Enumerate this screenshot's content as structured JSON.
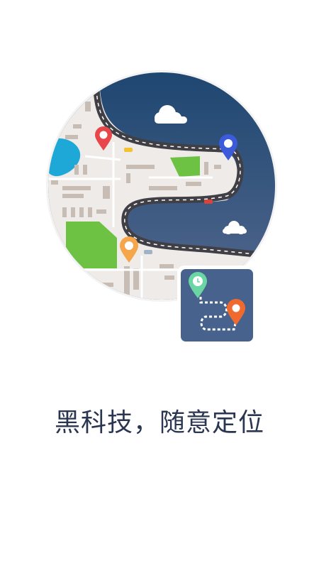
{
  "splash": {
    "tagline": "黑科技，随意定位"
  },
  "illustration": {
    "semantic": "map-with-route-and-pins",
    "colors": {
      "sky_top": "#1d4670",
      "sky_bottom": "#55698f",
      "map_ground": "#efebe8",
      "road": "#3f3f45",
      "road_dash": "#ffffff",
      "park": "#6dc244",
      "lake": "#1ea8d8",
      "building": "#c8bdb4",
      "cloud": "#ffffff",
      "pin_red": "#e8464a",
      "pin_blue": "#3b5bdb",
      "pin_orange": "#f5a54a",
      "badge_bg": "#47638d",
      "badge_pin_green": "#69d6a4",
      "badge_pin_orange": "#f06a2f"
    }
  }
}
